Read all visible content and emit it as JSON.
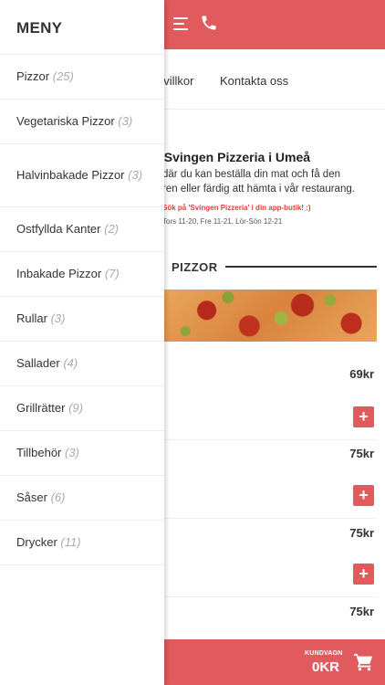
{
  "header": {
    "menu_icon": "hamburger-menu-icon",
    "phone_icon": "phone-icon",
    "accent_color": "#e15a5e"
  },
  "nav": {
    "links": [
      "pvillkor",
      "Kontakta oss"
    ]
  },
  "intro": {
    "title": "l Svingen Pizzeria i Umeå",
    "text": "där du kan beställa din mat och få den\nren eller färdig att hämta i vår restaurang.",
    "app_note": "Sök på 'Svingen Pizzeria' i din app-butik! :)",
    "hours": "Tors 11-20, Fre 11-21, Lör-Sön 12-21"
  },
  "section": {
    "title": "PIZZOR"
  },
  "products": [
    {
      "price": "69kr"
    },
    {
      "price": "75kr"
    },
    {
      "price": "75kr"
    },
    {
      "price": "75kr"
    }
  ],
  "add_button_label": "+",
  "cart": {
    "label": "KUNDVAGN",
    "total": "0KR",
    "icon": "cart-icon"
  },
  "menu": {
    "title": "MENY",
    "items": [
      {
        "label": "Pizzor",
        "count": "(25)"
      },
      {
        "label": "Vegetariska Pizzor",
        "count": "(3)"
      },
      {
        "label": "Halvinbakade Pizzor",
        "count": "(3)"
      },
      {
        "label": "Ostfyllda Kanter",
        "count": "(2)"
      },
      {
        "label": "Inbakade Pizzor",
        "count": "(7)"
      },
      {
        "label": "Rullar",
        "count": "(3)"
      },
      {
        "label": "Sallader",
        "count": "(4)"
      },
      {
        "label": "Grillrätter",
        "count": "(9)"
      },
      {
        "label": "Tillbehör",
        "count": "(3)"
      },
      {
        "label": "Såser",
        "count": "(6)"
      },
      {
        "label": "Drycker",
        "count": "(11)"
      }
    ]
  }
}
